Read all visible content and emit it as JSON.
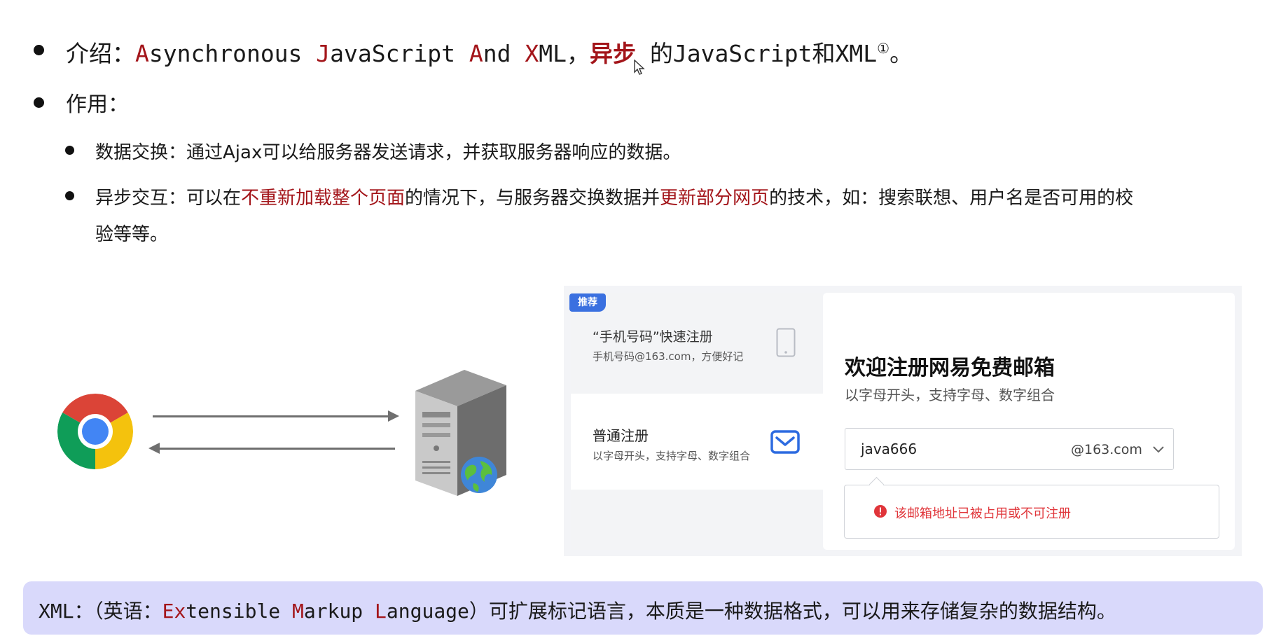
{
  "intro": {
    "label": "介绍：",
    "a1": "A",
    "a1_rest": "synchronous ",
    "j1": "J",
    "j1_rest": "avaScript ",
    "an1": "A",
    "an1_rest": "nd ",
    "x1": "X",
    "x1_rest": "ML，",
    "async_cn": "异步",
    "suffix": " 的JavaScript和XML",
    "footnote_mark": "①",
    "end": "。"
  },
  "purpose": {
    "label": "作用："
  },
  "data_exchange": {
    "text": "数据交换：通过Ajax可以给服务器发送请求，并获取服务器响应的数据。"
  },
  "async_interaction": {
    "p1": "异步交互：可以在",
    "r1": "不重新加载整个页面",
    "p2": "的情况下，与服务器交换数据并",
    "r2": "更新部分网页",
    "p3": "的技术，如：搜索联想、用户名是否可用的校",
    "p4": "验等等。"
  },
  "mail_form": {
    "badge": "推荐",
    "option1_title": "“手机号码”快速注册",
    "option1_sub": "手机号码@163.com，方便好记",
    "option2_title": "普通注册",
    "option2_sub": "以字母开头，支持字母、数字组合",
    "heading": "欢迎注册网易免费邮箱",
    "subheading": "以字母开头，支持字母、数字组合",
    "username_value": "java666",
    "domain": "@163.com",
    "error": "该邮箱地址已被占用或不可注册",
    "colors": {
      "badge": "#3a70e0",
      "error": "#e0353a"
    }
  },
  "footnote": {
    "prefix": "XML：（英语：",
    "e": "E",
    "e_rest1": "",
    "x": "x",
    "e_rest2": "tensible ",
    "m": "M",
    "m_rest": "arkup ",
    "l": "L",
    "l_rest": "anguage",
    "suffix": "）可扩展标记语言，本质是一种数据格式，可以用来存储复杂的数据结构。"
  },
  "icons": [
    "chrome-icon",
    "server-icon",
    "globe-icon",
    "phone-icon",
    "mail-icon",
    "error-icon",
    "chevron-down-icon",
    "mouse-cursor-icon"
  ]
}
